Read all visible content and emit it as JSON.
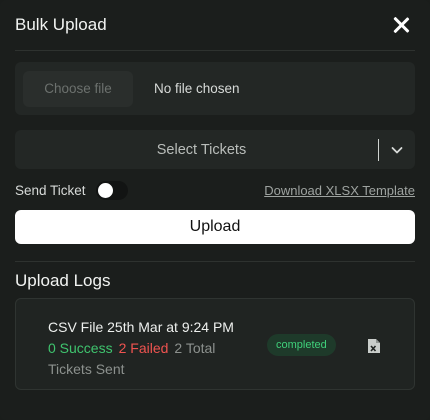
{
  "header": {
    "title": "Bulk Upload",
    "close_icon": "close-icon"
  },
  "file_input": {
    "button_label": "Choose file",
    "status": "No file chosen"
  },
  "tickets_select": {
    "placeholder": "Select Tickets",
    "chevron_icon": "chevron-down-icon"
  },
  "send_ticket": {
    "label": "Send Ticket",
    "enabled": false
  },
  "download_link": {
    "label": "Download XLSX Template"
  },
  "upload_button": {
    "label": "Upload"
  },
  "logs": {
    "title": "Upload Logs",
    "items": [
      {
        "title": "CSV File 25th Mar at 9:24 PM",
        "success": "0 Success",
        "failed": "2 Failed",
        "total": "2 Total",
        "sent": "Tickets Sent",
        "status": "completed",
        "icon": "file-excel-icon"
      }
    ]
  },
  "colors": {
    "background": "#1b1e1c",
    "success": "#3fc46e",
    "failed": "#ef5350",
    "status_badge_bg": "#1e3a2a",
    "status_badge_text": "#3fd07a"
  }
}
